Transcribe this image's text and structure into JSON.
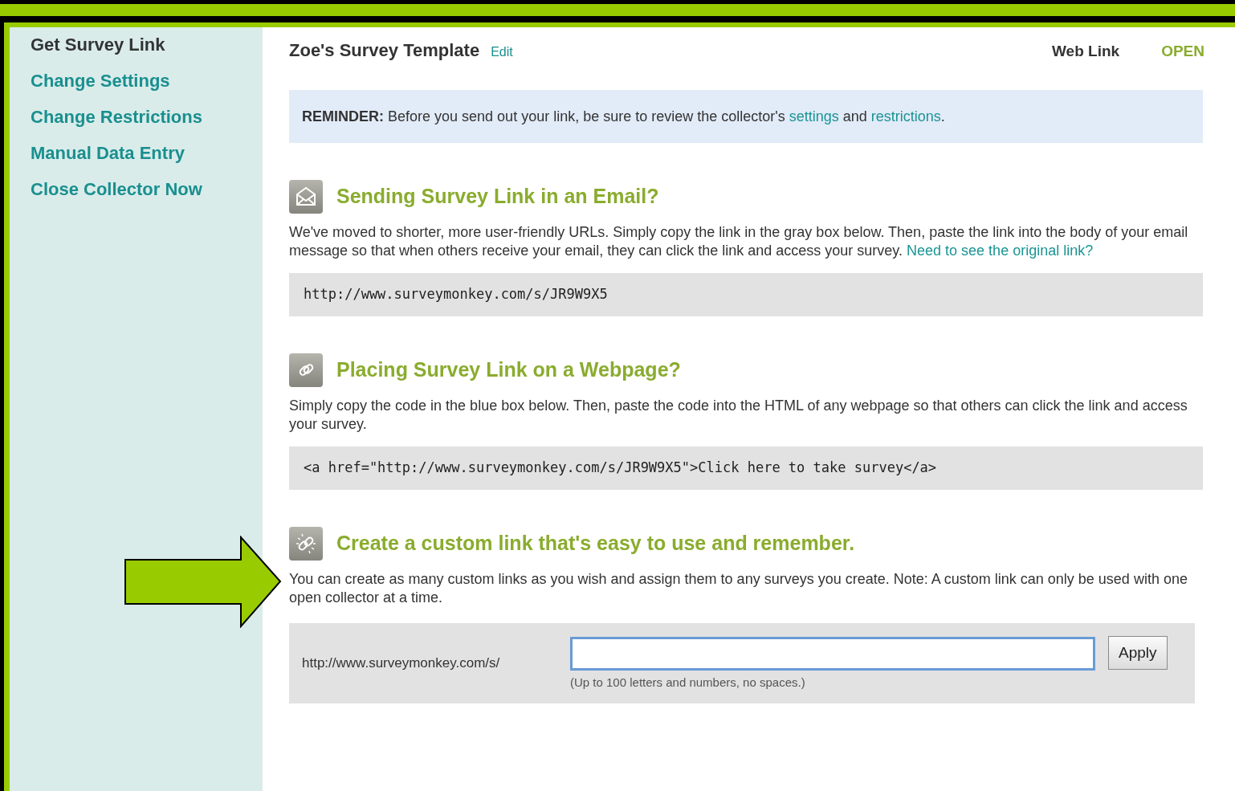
{
  "sidebar": {
    "items": [
      {
        "label": "Get Survey Link",
        "selected": true
      },
      {
        "label": "Change Settings",
        "selected": false
      },
      {
        "label": "Change Restrictions",
        "selected": false
      },
      {
        "label": "Manual Data Entry",
        "selected": false
      },
      {
        "label": "Close Collector Now",
        "selected": false
      }
    ]
  },
  "header": {
    "title": "Zoe's Survey Template",
    "edit_link": "Edit",
    "collector_type": "Web Link",
    "status": "OPEN"
  },
  "reminder": {
    "label": "REMINDER:",
    "text": "Before you send out your link, be sure to review the collector's",
    "link_1": "settings",
    "joiner": "and",
    "link_2": "restrictions",
    "end": "."
  },
  "sections": [
    {
      "kind": "email",
      "title": "Sending Survey Link in an Email?",
      "body": "We've moved to shorter, more user-friendly URLs. Simply copy the link in the gray box below. Then, paste the link into the body of your email message so that when others receive your email, they can click the link and access your survey.",
      "body_link": "Need to see the original link?",
      "code": "http://www.surveymonkey.com/s/JR9W9X5"
    },
    {
      "kind": "webpage",
      "title": "Placing Survey Link on a Webpage?",
      "body": "Simply copy the code in the blue box below. Then, paste the code into the HTML of any webpage so that others can click the link and access your survey.",
      "code": "<a href=\"http://www.surveymonkey.com/s/JR9W9X5\">Click here to take survey</a>"
    },
    {
      "kind": "custom",
      "title": "Create a custom link that's easy to use and remember.",
      "body": "You can create as many custom links as you wish and assign them to any surveys you create. Note: A custom link can only be used with one open collector at a time.",
      "prefix": "http://www.surveymonkey.com/s/",
      "hint": "(Up to 100 letters and numbers, no spaces.)",
      "button": "Apply"
    }
  ]
}
